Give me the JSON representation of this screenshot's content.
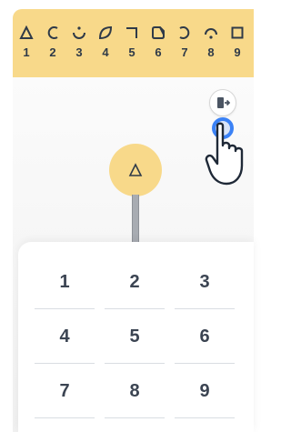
{
  "toolbar": {
    "shapes": [
      {
        "icon": "triangle-icon",
        "num": "1"
      },
      {
        "icon": "c-curve-icon",
        "num": "2"
      },
      {
        "icon": "smile-arc-icon",
        "num": "3"
      },
      {
        "icon": "leaf-icon",
        "num": "4"
      },
      {
        "icon": "corner-bracket-icon",
        "num": "5"
      },
      {
        "icon": "rounded-square-cut-icon",
        "num": "6"
      },
      {
        "icon": "reverse-c-curve-icon",
        "num": "7"
      },
      {
        "icon": "arch-dot-icon",
        "num": "8"
      },
      {
        "icon": "square-icon",
        "num": "9"
      }
    ]
  },
  "canvas": {
    "exit_icon": "exit-door-icon",
    "node_icon": "triangle-icon"
  },
  "keypad": {
    "keys": [
      "1",
      "2",
      "3",
      "4",
      "5",
      "6",
      "7",
      "8",
      "9"
    ]
  },
  "colors": {
    "toolbar_bg": "#f8d98a",
    "node_bg": "#f8d98a",
    "touch_ring": "#3b82f6",
    "digit_text": "#3b4452"
  }
}
